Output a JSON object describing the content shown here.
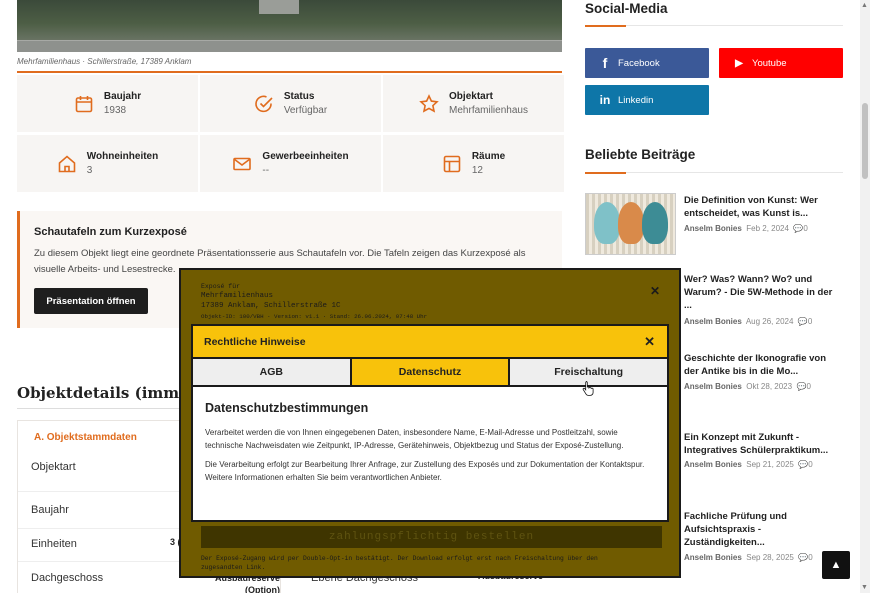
{
  "photo": {
    "caption": "Mehrfamilienhaus · Schillerstraße, 17389 Anklam"
  },
  "info_cells": [
    {
      "icon": "calendar-icon",
      "label": "Baujahr",
      "value": "1938"
    },
    {
      "icon": "check-circle-icon",
      "label": "Status",
      "value": "Verfügbar"
    },
    {
      "icon": "star-icon",
      "label": "Objektart",
      "value": "Mehrfamilienhaus"
    },
    {
      "icon": "home-icon",
      "label": "Wohneinheiten",
      "value": "3"
    },
    {
      "icon": "mail-icon",
      "label": "Gewerbeeinheiten",
      "value": "--"
    },
    {
      "icon": "layout-icon",
      "label": "Räume",
      "value": "12"
    }
  ],
  "schautafeln": {
    "title": "Schautafeln zum Kurzexposé",
    "text": "Zu diesem Objekt liegt eine geordnete Präsentationsserie aus Schautafeln vor. Die Tafeln zeigen das Kurzexposé als visuelle Arbeits- und Lesestrecke.",
    "button": "Präsentation öffnen"
  },
  "objektdetails": {
    "heading": "Objektdetails (immoS",
    "section": "A. Objektstammdaten",
    "rows": [
      {
        "label": "Objektart",
        "value": ""
      },
      {
        "label": "Baujahr",
        "value": ""
      },
      {
        "label": "Einheiten",
        "value": "3 ("
      },
      {
        "label": "Dachgeschoss",
        "value": "Ausbaureserve (Option)"
      }
    ],
    "right_label": "Ebene Dachgeschoss",
    "right_value": "Ausbaureserve"
  },
  "sidebar": {
    "social_heading": "Social-Media",
    "social": [
      {
        "label": "Facebook",
        "glyph": "f",
        "color": "#3b5998"
      },
      {
        "label": "Youtube",
        "glyph": "▶",
        "color": "#ff0000"
      },
      {
        "label": "Linkedin",
        "glyph": "in",
        "color": "#0e76a8"
      }
    ],
    "posts_heading": "Beliebte Beiträge",
    "posts": [
      {
        "title": "Die Definition von Kunst: Wer entscheidet, was Kunst is...",
        "author": "Anselm Bonies",
        "date": "Feb 2, 2024",
        "comments": "0"
      },
      {
        "title": "Wer? Was? Wann? Wo? und Warum? - Die 5W-Methode in der ...",
        "author": "Anselm Bonies",
        "date": "Aug 26, 2024",
        "comments": "0"
      },
      {
        "title": "Geschichte der Ikonografie von der Antike bis in die Mo...",
        "author": "Anselm Bonies",
        "date": "Okt 28, 2023",
        "comments": "0"
      },
      {
        "title": "Ein Konzept mit Zukunft - Integratives Schülerpraktikum...",
        "author": "Anselm Bonies",
        "date": "Sep 21, 2025",
        "comments": "0"
      },
      {
        "title": "Fachliche Prüfung und Aufsichtspraxis - Zuständigkeiten...",
        "author": "Anselm Bonies",
        "date": "Sep 28, 2025",
        "comments": "0"
      }
    ]
  },
  "expose": {
    "line1": "Exposé für",
    "line2": "Mehrfamilienhaus",
    "line3": "17389 Anklam, Schillerstraße 1C",
    "line4": "Objekt-ID: 100/VBH · Version: v1.1 · Stand: 26.06.2024, 07:48 Uhr",
    "order_button": "zahlungspflichtig bestellen",
    "footer": "Der Exposé-Zugang wird per Double-Opt-in bestätigt. Der Download erfolgt erst nach Freischaltung über den zugesandten Link."
  },
  "dialog": {
    "title": "Rechtliche Hinweise",
    "tabs": [
      "AGB",
      "Datenschutz",
      "Freischaltung"
    ],
    "active_tab": "Datenschutz",
    "heading": "Datenschutzbestimmungen",
    "p1": "Verarbeitet werden die von Ihnen eingegebenen Daten, insbesondere Name, E-Mail-Adresse und Postleitzahl, sowie technische Nachweisdaten wie Zeitpunkt, IP-Adresse, Gerätehinweis, Objektbezug und Status der Exposé-Zustellung.",
    "p2": "Die Verarbeitung erfolgt zur Bearbeitung Ihrer Anfrage, zur Zustellung des Exposés und zur Dokumentation der Kontaktspur. Weitere Informationen erhalten Sie beim verantwortlichen Anbieter."
  },
  "colors": {
    "accent": "#e06c1e",
    "dialog_yellow": "#f8c20b",
    "overlay": "#705b00"
  }
}
